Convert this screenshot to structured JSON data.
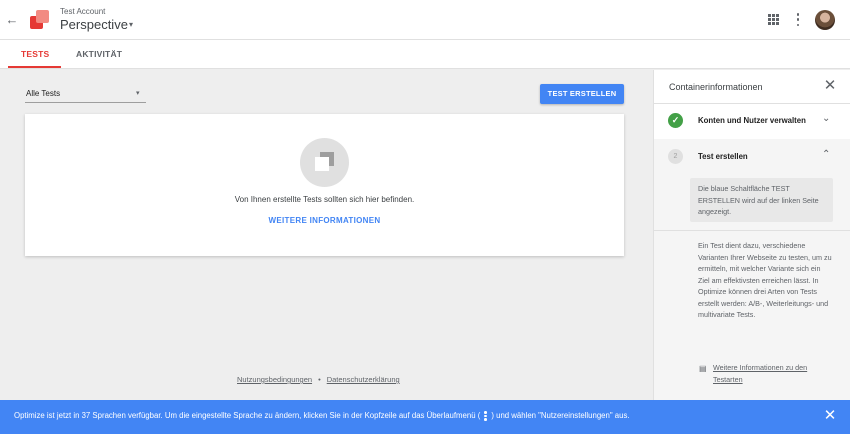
{
  "header": {
    "back_icon": "←",
    "account_label": "Test Account",
    "container_name": "Perspective",
    "container_caret": "▾",
    "apps_icon": "apps-grid-icon",
    "menu_icon": "more-vert-icon",
    "avatar": "user-avatar"
  },
  "tabs": [
    {
      "label": "TESTS",
      "active": true
    },
    {
      "label": "AKTIVITÄT",
      "active": false
    }
  ],
  "toolbar": {
    "filter_value": "Alle Tests",
    "filter_caret": "▾",
    "create_label": "TEST ERSTELLEN"
  },
  "empty_state": {
    "message": "Von Ihnen erstellte Tests sollten sich hier befinden.",
    "link_label": "WEITERE INFORMATIONEN"
  },
  "footer": {
    "terms": "Nutzungsbedingungen",
    "separator": "•",
    "privacy": "Datenschutzerklärung"
  },
  "panel": {
    "title": "Containerinformationen",
    "close_icon": "✕",
    "steps": [
      {
        "status": "done",
        "icon": "✓",
        "label": "Konten und Nutzer verwalten",
        "chevron": "⌄"
      },
      {
        "status": "open",
        "number": "2",
        "label": "Test erstellen",
        "chevron": "⌃"
      }
    ],
    "hint": "Die blaue Schaltfläche TEST ERSTELLEN wird auf der linken Seite angezeigt.",
    "description": "Ein Test dient dazu, verschiedene Varianten Ihrer Webseite zu testen, um zu ermitteln, mit welcher Variante sich ein Ziel am effektivsten erreichen lässt. In Optimize können drei Arten von Tests erstellt werden: A/B-, Weiterleitungs- und multivariate Tests.",
    "doc_icon": "▤",
    "doc_link": "Weitere Informationen zu den Testarten"
  },
  "banner": {
    "text_before": "Optimize ist jetzt in 37 Sprachen verfügbar. Um die eingestellte Sprache zu ändern, klicken Sie in der Kopfzeile auf das Überlaufmenü (",
    "text_after": ") und wählen \"Nutzereinstellungen\" aus.",
    "close_icon": "✕"
  },
  "colors": {
    "accent_red": "#e53935",
    "primary_blue": "#4285f4",
    "success_green": "#43a047"
  }
}
